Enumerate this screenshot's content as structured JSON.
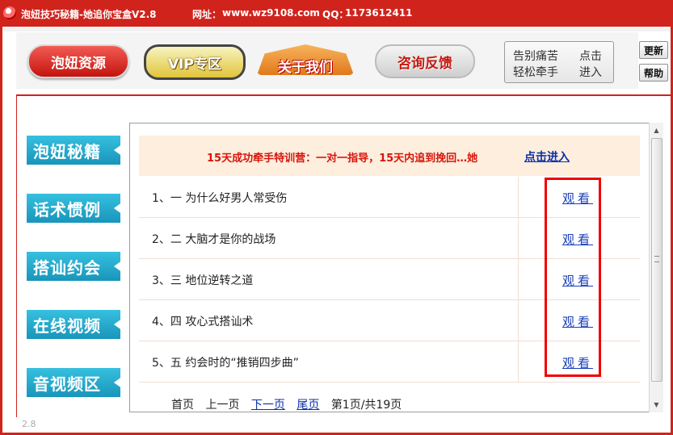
{
  "window": {
    "title": "泡妞技巧秘籍-她追你宝盒V2.8",
    "url_label": "网址：",
    "url": "www.wz9108.com",
    "qq_label": "QQ：",
    "qq": "1173612411",
    "frame_color": "#d0231c",
    "version": "2.8"
  },
  "toolbar": {
    "nav": [
      {
        "label": "泡妞资源"
      },
      {
        "label": "VIP专区"
      },
      {
        "label": "关于我们"
      },
      {
        "label": "咨询反馈"
      }
    ],
    "promo": {
      "line1_left": "告别痛苦",
      "line1_right": "点击",
      "line2_left": "轻松牵手",
      "line2_right": "进入"
    },
    "update_label": "更新",
    "help_label": "帮助"
  },
  "sidebar": {
    "items": [
      {
        "label": "泡妞秘籍"
      },
      {
        "label": "话术惯例"
      },
      {
        "label": "搭讪约会"
      },
      {
        "label": "在线视频"
      },
      {
        "label": "音视频区"
      }
    ]
  },
  "main": {
    "banner": {
      "text": "15天成功牵手特训营：一对一指导，15天内追到挽回…她",
      "link": "点击进入"
    },
    "rows": [
      {
        "title": "1、一 为什么好男人常受伤",
        "action": "观看"
      },
      {
        "title": "2、二 大脑才是你的战场",
        "action": "观看"
      },
      {
        "title": "3、三 地位逆转之道",
        "action": "观看"
      },
      {
        "title": "4、四 攻心式搭讪术",
        "action": "观看"
      },
      {
        "title": "5、五 约会时的“推销四步曲”",
        "action": "观看"
      }
    ],
    "pager": {
      "first": "首页",
      "prev": "上一页",
      "next": "下一页",
      "last": "尾页",
      "status": "第1页/共19页"
    }
  },
  "colors": {
    "accent_red": "#d0231c",
    "menu_blue": "#1995bb",
    "link_blue": "#1a3eb8",
    "highlight_red": "#f00000"
  }
}
